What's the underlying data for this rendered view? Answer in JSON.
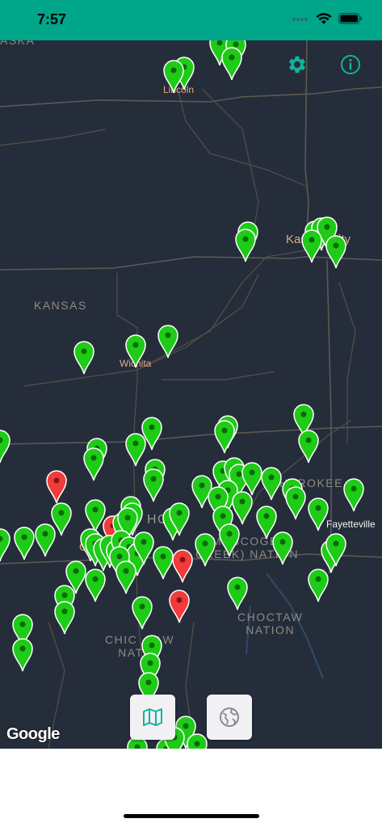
{
  "status_bar": {
    "time": "7:57",
    "background": "#00a68a"
  },
  "map": {
    "background": "#252d3b",
    "labels": {
      "state_kansas": "KANSAS",
      "region_top_left": "ASKA",
      "cherokee": "HEROKEE",
      "muscogee": "MUSCOGEE",
      "creek_nation": "CREEK) NATION",
      "choctaw": "CHOCTAW\nNATION",
      "chickasaw": "CHIC    AW\nNAT  N",
      "ohio_partial": "HO"
    },
    "cities": {
      "lincoln": "Lincoln",
      "kansas_city": "Kansas City",
      "wichita": "Wichita",
      "fayetteville": "Fayetteville",
      "oklahoma_partial": "O"
    },
    "attribution": "Google",
    "pin_colors": {
      "active": "#1ecb16",
      "alert": "#f23b3b",
      "outline": "#ffffff"
    }
  },
  "toolbar": {
    "settings_icon": "gear-icon",
    "info_icon": "info-icon",
    "accent": "#11b39c"
  },
  "view_modes": {
    "map_icon": "map-icon",
    "globe_icon": "globe-icon"
  }
}
